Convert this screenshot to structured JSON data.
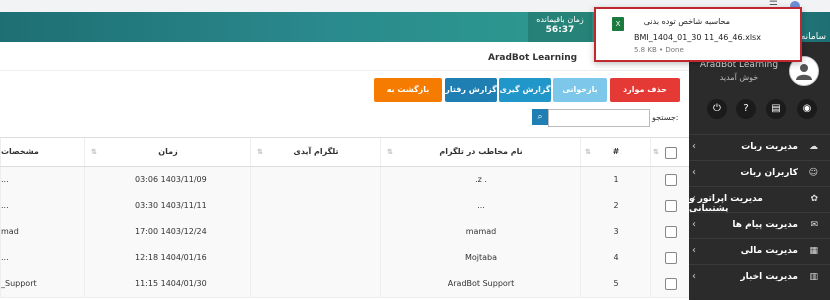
{
  "topbar": {
    "app_title": "سامانه",
    "timer_label": "زمان باقیمانده",
    "timer_value": "56:37"
  },
  "download": {
    "title": "محاسبه شاخص توده بدنی",
    "filename": "BMI_1404_01_30 11_46_46.xlsx",
    "status": "5.8 KB • Done",
    "icon": "excel-file-icon"
  },
  "page": {
    "title": "AradBot Learning"
  },
  "sidebar": {
    "brand": "AradBot Learning",
    "welcome": "خوش آمدید",
    "icons": [
      "power-icon",
      "help-icon",
      "book-icon",
      "user-icon"
    ],
    "items": [
      {
        "label": "مدیریت ربات"
      },
      {
        "label": "کاربران ربات"
      },
      {
        "label": "مدیریت اپراتور و پشتیبانی"
      },
      {
        "label": "مدیریت پیام ها"
      },
      {
        "label": "مدیریت مالی"
      },
      {
        "label": "مدیریت اخبار"
      }
    ]
  },
  "actions": {
    "delete": "حذف موارد انتخابی",
    "retry": "بازخوانی",
    "report": "گزارش گیری",
    "tracking": "گزارش رفتار",
    "back": "بازگشت به لیست"
  },
  "search": {
    "label": "جستجو:",
    "value": ""
  },
  "table": {
    "headers": {
      "index": "#",
      "name": "نام مخاطب در تلگرام",
      "telegram_id": "تلگرام آیدی",
      "time": "زمان",
      "details": "مشخصات"
    },
    "rows": [
      {
        "index": "1",
        "name": ".z .",
        "telegram_id": "",
        "time": "03:06 1403/11/09",
        "details": "..."
      },
      {
        "index": "2",
        "name": "...",
        "telegram_id": "",
        "time": "03:30 1403/11/11",
        "details": "..."
      },
      {
        "index": "3",
        "name": "mamad",
        "telegram_id": "",
        "time": "17:00 1403/12/24",
        "details": "mad"
      },
      {
        "index": "4",
        "name": "Mojtaba",
        "telegram_id": "",
        "time": "12:18 1404/01/16",
        "details": "..."
      },
      {
        "index": "5",
        "name": "AradBot Support",
        "telegram_id": "",
        "time": "11:15 1404/01/30",
        "details": "_Support"
      }
    ]
  }
}
